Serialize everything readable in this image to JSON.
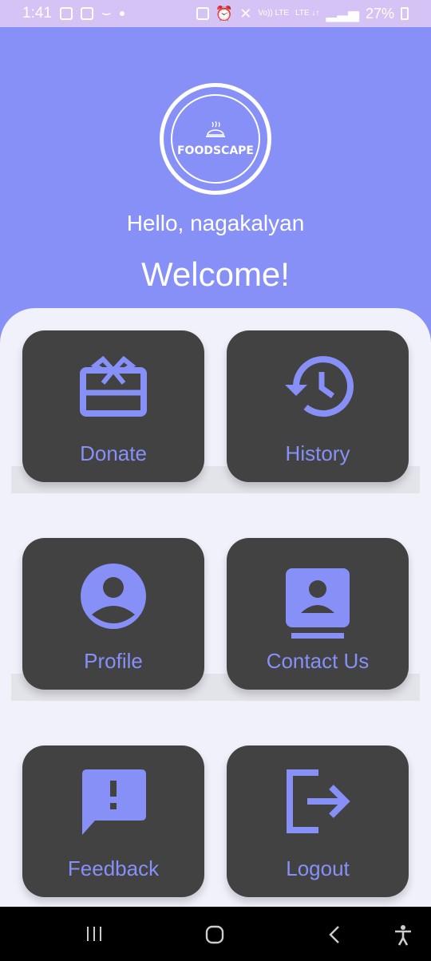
{
  "status_bar": {
    "time": "1:41",
    "battery_percent": "27%",
    "lte1": "Vo)) LTE",
    "lte2": "LTE ↓↑"
  },
  "header": {
    "logo_text": "FOODSCAPE",
    "greeting": "Hello, nagakalyan",
    "welcome": "Welcome!"
  },
  "menu": {
    "items": [
      {
        "label": "Donate",
        "icon": "gift-card-icon"
      },
      {
        "label": "History",
        "icon": "history-icon"
      },
      {
        "label": "Profile",
        "icon": "account-circle-icon"
      },
      {
        "label": "Contact Us",
        "icon": "contact-card-icon"
      },
      {
        "label": "Feedback",
        "icon": "feedback-icon"
      },
      {
        "label": "Logout",
        "icon": "logout-icon"
      }
    ]
  },
  "colors": {
    "accent": "#8690f7",
    "card": "#424242",
    "panel": "#f1f1fb"
  },
  "nav": {
    "recent": "recent-apps-icon",
    "home": "home-icon",
    "back": "back-icon",
    "accessibility": "accessibility-icon"
  }
}
